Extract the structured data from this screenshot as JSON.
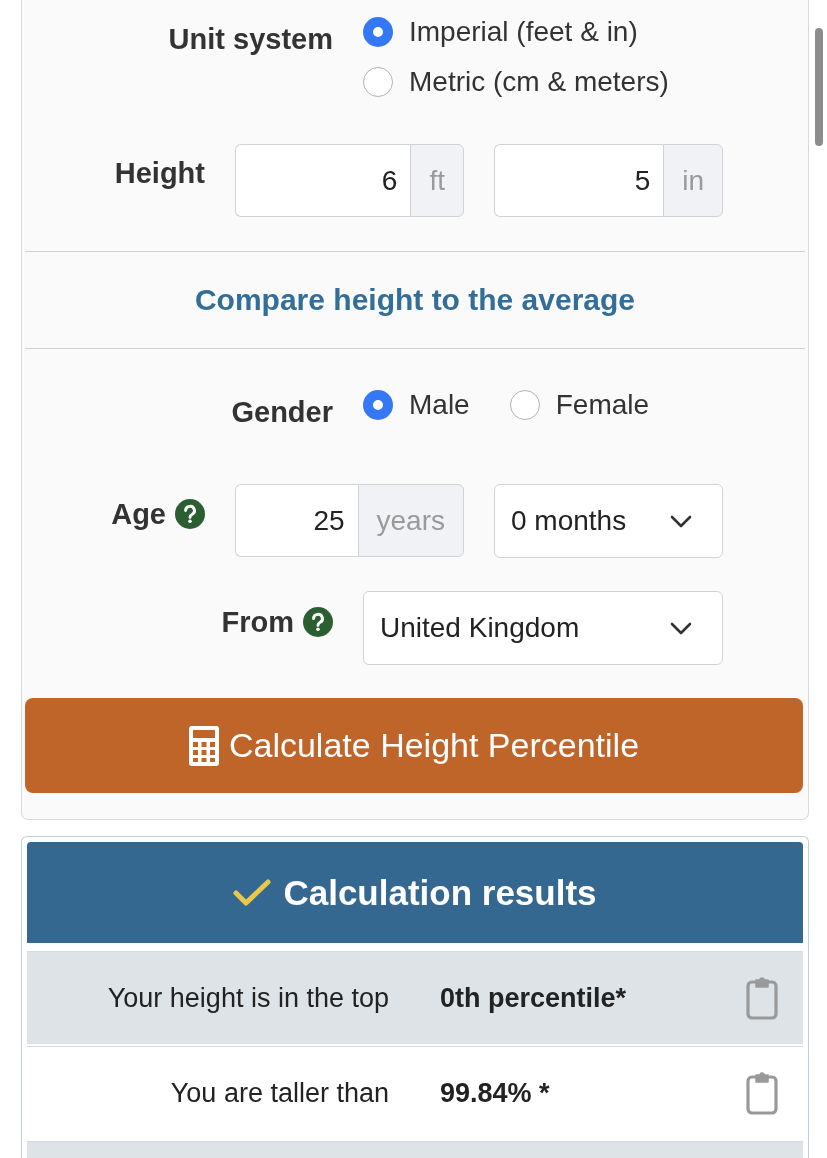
{
  "unit_system": {
    "label": "Unit system",
    "options": [
      {
        "label": "Imperial (feet & in)",
        "selected": true
      },
      {
        "label": "Metric (cm & meters)",
        "selected": false
      }
    ]
  },
  "height": {
    "label": "Height",
    "fields": [
      {
        "value": "6",
        "unit": "ft"
      },
      {
        "value": "5",
        "unit": "in"
      }
    ]
  },
  "comparison_heading": "Compare height to the average",
  "gender": {
    "label": "Gender",
    "options": [
      {
        "label": "Male",
        "selected": true
      },
      {
        "label": "Female",
        "selected": false
      }
    ]
  },
  "age": {
    "label": "Age",
    "years": {
      "value": "25",
      "unit": "years"
    },
    "months": "0 months"
  },
  "origin": {
    "label": "From",
    "country": "United Kingdom"
  },
  "calculate_button": "Calculate Height Percentile",
  "results": {
    "title": "Calculation results",
    "rows": [
      {
        "label": "Your height is in the top",
        "value": "0th percentile*"
      },
      {
        "label": "You are taller than",
        "value": "99.84% *"
      }
    ]
  }
}
